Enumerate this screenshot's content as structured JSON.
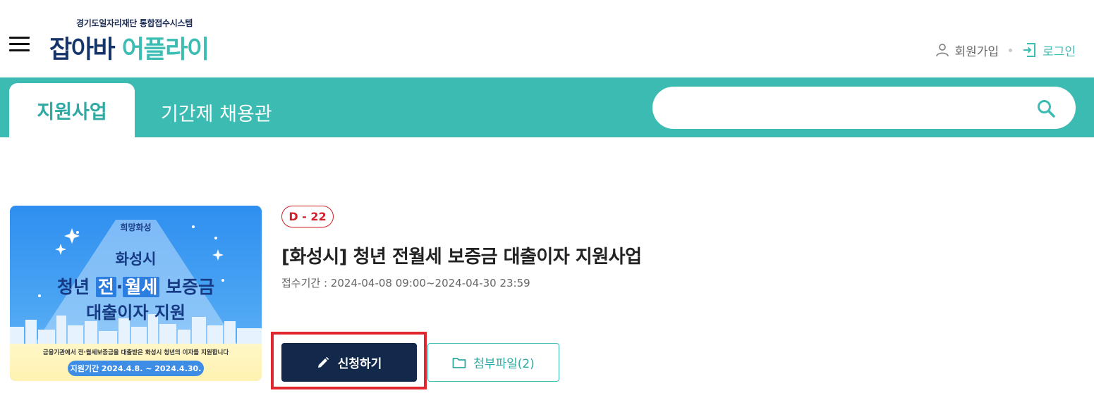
{
  "header": {
    "logo_subtitle": "경기도일자리재단 통합접수시스템",
    "logo_part1": "잡아바 ",
    "logo_part2": "어플",
    "logo_part3": "라이",
    "join_label": "회원가입",
    "login_label": "로그인"
  },
  "nav": {
    "tabs": [
      {
        "label": "지원사업",
        "active": true
      },
      {
        "label": "기간제 채용관",
        "active": false
      }
    ],
    "search_value": ""
  },
  "program": {
    "dday": "D - 22",
    "title": "[화성시] 청년 전월세 보증금 대출이자 지원사업",
    "period_label": "접수기간 : ",
    "period_value": "2024-04-08 09:00~2024-04-30 23:59",
    "apply_label": "신청하기",
    "attach_label": "첨부파일(2)"
  },
  "thumbnail": {
    "logo_text": "희망화성",
    "city": "화성시",
    "line1_a": "청년 ",
    "line1_hl1": "전",
    "line1_mid": "·",
    "line1_hl2": "월세",
    "line1_b": " 보증금",
    "line2": "대출이자 지원",
    "desc": "금융기관에서 전·월세보증금을 대출받은 화성시 청년의 이자를 지원합니다",
    "period": "지원기간 2024.4.8. ~ 2024.4.30."
  },
  "colors": {
    "teal": "#3bbbb2",
    "navy": "#13294b",
    "dday_red": "#d01f2b",
    "highlight_red": "#e0262f"
  }
}
